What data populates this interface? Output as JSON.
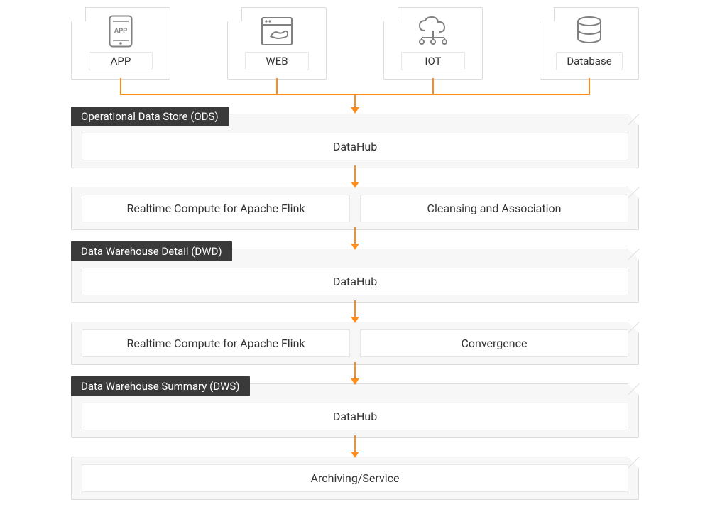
{
  "sources": [
    {
      "id": "app",
      "label": "APP",
      "icon": "app-icon"
    },
    {
      "id": "web",
      "label": "WEB",
      "icon": "web-icon"
    },
    {
      "id": "iot",
      "label": "IOT",
      "icon": "iot-icon"
    },
    {
      "id": "database",
      "label": "Database",
      "icon": "database-icon"
    }
  ],
  "layers": {
    "ods": {
      "title": "Operational Data Store (ODS)",
      "content": "DataHub"
    },
    "process1": {
      "left": "Realtime Compute for Apache Flink",
      "right": "Cleansing and Association"
    },
    "dwd": {
      "title": "Data Warehouse Detail (DWD)",
      "content": "DataHub"
    },
    "process2": {
      "left": "Realtime Compute for Apache Flink",
      "right": "Convergence"
    },
    "dws": {
      "title": "Data Warehouse Summary (DWS)",
      "content": "DataHub"
    },
    "final": {
      "content": "Archiving/Service"
    }
  },
  "colors": {
    "accent": "#ff8c1a",
    "panel_bg": "#f7f7f7",
    "label_bg": "#3a3a3a"
  }
}
